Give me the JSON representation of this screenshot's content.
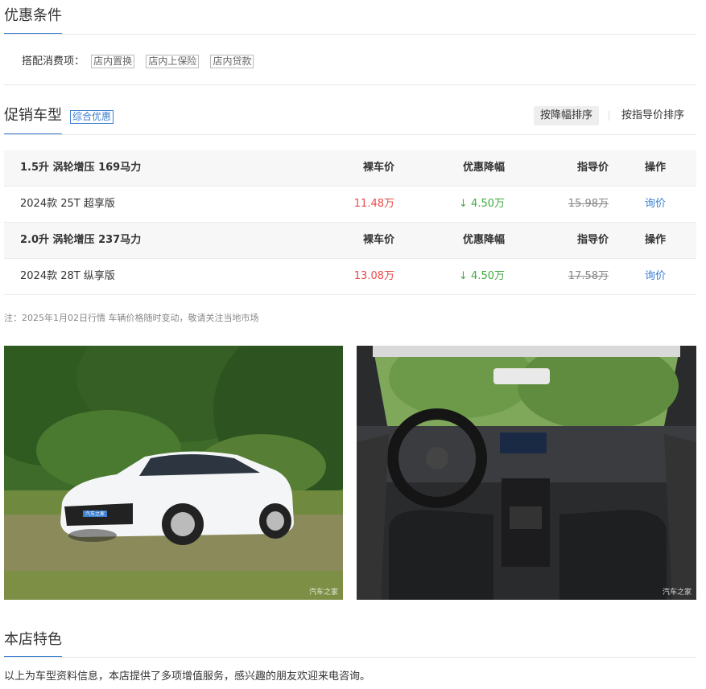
{
  "offer": {
    "title": "优惠条件",
    "label": "搭配消费项：",
    "tags": [
      "店内置换",
      "店内上保险",
      "店内贷款"
    ]
  },
  "promo": {
    "title": "促销车型",
    "badge": "综合优惠",
    "sort_discount": "按降幅排序",
    "sort_guide": "按指导价排序"
  },
  "table": {
    "groups": [
      {
        "engine": "1.5升 涡轮增压 169马力",
        "headers": {
          "price": "裸车价",
          "discount": "优惠降幅",
          "guide": "指导价",
          "op": "操作"
        },
        "model": "2024款 25T 超享版",
        "price": "11.48万",
        "discount": "4.50万",
        "guide": "15.98万",
        "op": "询价"
      },
      {
        "engine": "2.0升 涡轮增压 237马力",
        "headers": {
          "price": "裸车价",
          "discount": "优惠降幅",
          "guide": "指导价",
          "op": "操作"
        },
        "model": "2024款 28T 纵享版",
        "price": "13.08万",
        "discount": "4.50万",
        "guide": "17.58万",
        "op": "询价"
      }
    ],
    "arrow": "↓"
  },
  "note": "注：2025年1月02日行情 车辆价格随时变动，敬请关注当地市场",
  "photos": {
    "exterior_plate": "汽车之家",
    "watermark": "汽车之家"
  },
  "features": {
    "title": "本店特色",
    "text": "以上为车型资料信息，本店提供了多项增值服务，感兴趣的朋友欢迎来电咨询。"
  },
  "colors": {
    "accent": "#3b7fd0",
    "price_red": "#e84a4a",
    "discount_green": "#3dab3d"
  }
}
